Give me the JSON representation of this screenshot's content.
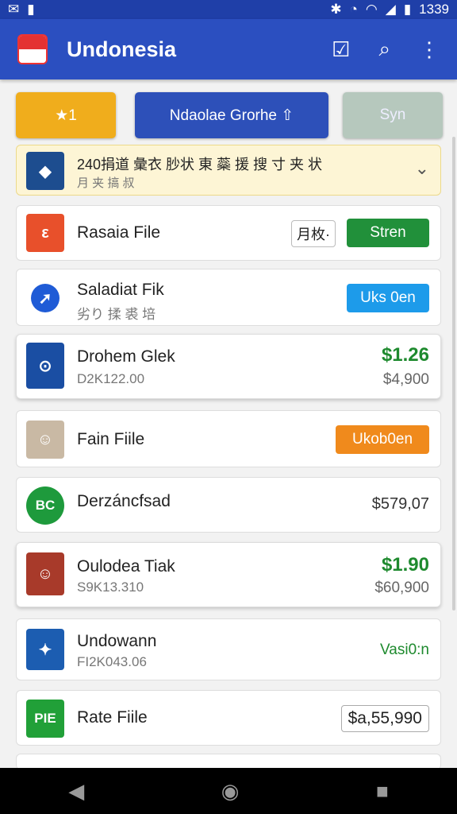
{
  "status": {
    "time": "1339"
  },
  "app": {
    "title": "Undonesia"
  },
  "buttons": {
    "star_label": "★1",
    "primary_label": "Ndaolae Grorhe ⇧",
    "sync_label": "Syn"
  },
  "list": [
    {
      "title": "240捐道 彙衣 䏚状 東 蘂 援 搜 寸 夹 状",
      "subtitle": "月 夹 搞 叔",
      "action": "⌄"
    },
    {
      "title": "Rasaia File",
      "chip": "月枚·",
      "button": "Stren"
    },
    {
      "title": "Saladiat Fik",
      "subtitle": "劣り 揉 裘 培",
      "button": "Uks 0en"
    },
    {
      "title": "Drohem Glek",
      "subtitle": "D2K122.00",
      "price": "$1.26",
      "price2": "$4,900"
    },
    {
      "title": "Fain Fiile",
      "button": "Ukob0en"
    },
    {
      "title": "Derzáncfsad",
      "price": "$579,07"
    },
    {
      "title": "Oulodea Tiak",
      "subtitle": "S9K13.310",
      "price": "$1.90",
      "price2": "$60,900"
    },
    {
      "title": "Undowann",
      "subtitle": "FI2K043.06",
      "right_text": "Vasi0:n"
    },
    {
      "title": "Rate Fiile",
      "price_box": "$a,55,990"
    }
  ],
  "thumbs": {
    "t2": "ε",
    "t6": "BC",
    "t9": "PIE"
  },
  "colors": {
    "appbar": "#2b4fc0",
    "green": "#1e8a2e",
    "orange": "#f08a1c",
    "blue": "#1d9bea"
  }
}
